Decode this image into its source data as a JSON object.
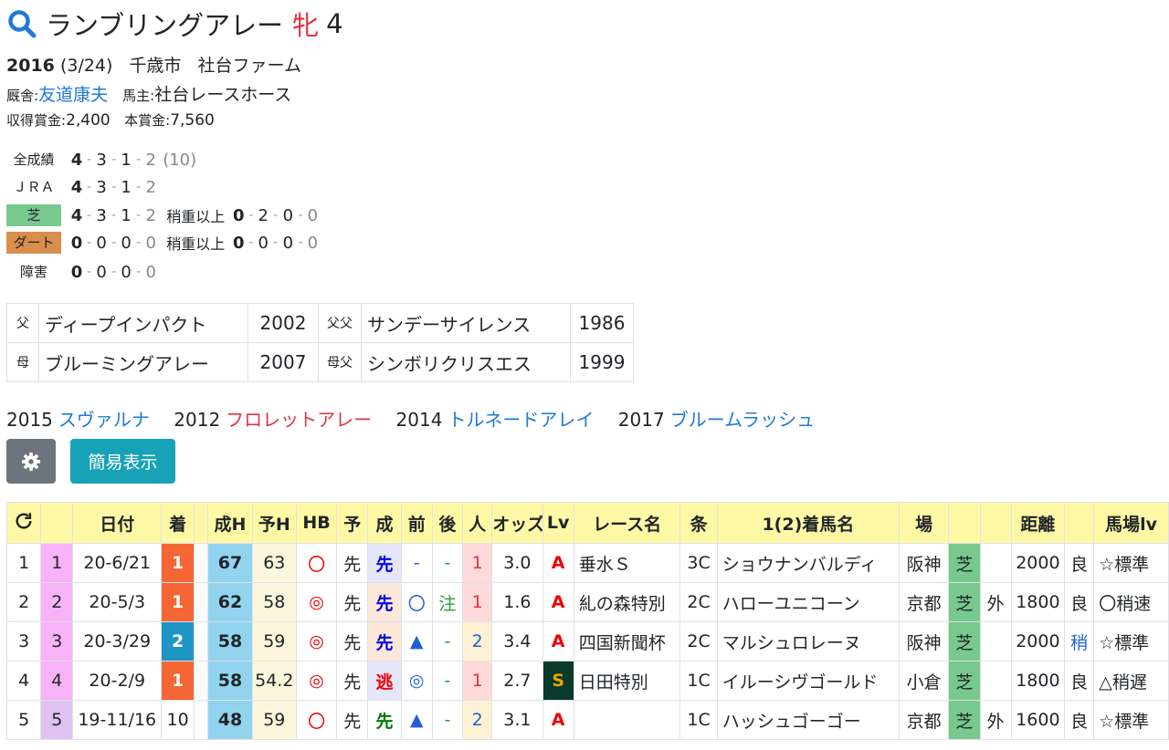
{
  "horse": {
    "name": "ランブリングアレー",
    "sex": "牝",
    "age": "4"
  },
  "birth": {
    "year": "2016",
    "date": "(3/24)",
    "place": "千歳市",
    "farm": "社台ファーム"
  },
  "stable": {
    "label": "厩舎:",
    "trainer": "友道康夫",
    "owner_label": "馬主:",
    "owner": "社台レースホース"
  },
  "prize": {
    "label1": "収得賞金:",
    "value1": "2,400",
    "label2": "本賞金:",
    "value2": "7,560"
  },
  "records": {
    "all": {
      "label": "全成績",
      "w": "4",
      "s": "3",
      "t": "1",
      "o": "2",
      "total": "(10)"
    },
    "jra": {
      "label": "ＪＲＡ",
      "w": "4",
      "s": "3",
      "t": "1",
      "o": "2"
    },
    "turf": {
      "label": "芝",
      "w": "4",
      "s": "3",
      "t": "1",
      "o": "2",
      "sub_label": "稍重以上",
      "sw": "0",
      "ss": "2",
      "st": "0",
      "so": "0"
    },
    "dirt": {
      "label": "ダート",
      "w": "0",
      "s": "0",
      "t": "0",
      "o": "0",
      "sub_label": "稍重以上",
      "sw": "0",
      "ss": "0",
      "st": "0",
      "so": "0"
    },
    "jump": {
      "label": "障害",
      "w": "0",
      "s": "0",
      "t": "0",
      "o": "0"
    }
  },
  "pedigree": {
    "sire": {
      "key": "父",
      "name": "ディープインパクト",
      "year": "2002"
    },
    "sire_sire": {
      "key": "父父",
      "name": "サンデーサイレンス",
      "year": "1986"
    },
    "dam": {
      "key": "母",
      "name": "ブルーミングアレー",
      "year": "2007"
    },
    "dam_sire": {
      "key": "母父",
      "name": "シンボリクリスエス",
      "year": "1999"
    }
  },
  "siblings": [
    {
      "year": "2015",
      "name": "スヴァルナ"
    },
    {
      "year": "2012",
      "name": "フロレットアレー"
    },
    {
      "year": "2014",
      "name": "トルネードアレイ"
    },
    {
      "year": "2017",
      "name": "ブルームラッシュ"
    }
  ],
  "buttons": {
    "simple": "簡易表示"
  },
  "table": {
    "headers": [
      "日付",
      "着",
      "成H",
      "予H",
      "HB",
      "予",
      "成",
      "前",
      "後",
      "人",
      "オッズ",
      "Lv",
      "レース名",
      "条",
      "1(2)着馬名",
      "場",
      "距離",
      "馬場lv"
    ],
    "rows": [
      {
        "no": "1",
        "no2": "1",
        "date": "20-6/21",
        "rank": "1",
        "sh": "67",
        "yh": "63",
        "hb": "〇",
        "yo": "先",
        "sei": "先",
        "mae": "-",
        "ato": "-",
        "pop": "1",
        "odds": "3.0",
        "lv": "A",
        "race": "垂水Ｓ",
        "cls": "3C",
        "winner": "ショウナンバルディ",
        "track": "阪神",
        "surf": "芝",
        "course": "",
        "dist": "2000",
        "cond": "良",
        "tlv": "☆標準"
      },
      {
        "no": "2",
        "no2": "2",
        "date": "20-5/3",
        "rank": "1",
        "sh": "62",
        "yh": "58",
        "hb": "◎",
        "yo": "先",
        "sei": "先",
        "mae": "〇",
        "ato": "注",
        "pop": "1",
        "odds": "1.6",
        "lv": "A",
        "race": "糺の森特別",
        "cls": "2C",
        "winner": "ハローユニコーン",
        "track": "京都",
        "surf": "芝",
        "course": "外",
        "dist": "1800",
        "cond": "良",
        "tlv": "〇稍速"
      },
      {
        "no": "3",
        "no2": "3",
        "date": "20-3/29",
        "rank": "2",
        "sh": "58",
        "yh": "59",
        "hb": "◎",
        "yo": "先",
        "sei": "先",
        "mae": "▲",
        "ato": "-",
        "pop": "2",
        "odds": "3.4",
        "lv": "A",
        "race": "四国新聞杯",
        "cls": "2C",
        "winner": "マルシュロレーヌ",
        "track": "阪神",
        "surf": "芝",
        "course": "",
        "dist": "2000",
        "cond": "稍",
        "tlv": "☆標準"
      },
      {
        "no": "4",
        "no2": "4",
        "date": "20-2/9",
        "rank": "1",
        "sh": "58",
        "yh": "54.2",
        "hb": "◎",
        "yo": "先",
        "sei": "逃",
        "mae": "◎",
        "ato": "-",
        "pop": "1",
        "odds": "2.7",
        "lv": "S",
        "race": "日田特別",
        "cls": "1C",
        "winner": "イルーシヴゴールド",
        "track": "小倉",
        "surf": "芝",
        "course": "",
        "dist": "1800",
        "cond": "良",
        "tlv": "△稍遅"
      },
      {
        "no": "5",
        "no2": "5",
        "date": "19-11/16",
        "rank": "10",
        "sh": "48",
        "yh": "59",
        "hb": "〇",
        "yo": "先",
        "sei": "先",
        "mae": "▲",
        "ato": "-",
        "pop": "2",
        "odds": "3.1",
        "lv": "A",
        "race": "",
        "cls": "1C",
        "winner": "ハッシュゴーゴー",
        "track": "京都",
        "surf": "芝",
        "course": "外",
        "dist": "1600",
        "cond": "良",
        "tlv": "☆標準"
      }
    ]
  }
}
